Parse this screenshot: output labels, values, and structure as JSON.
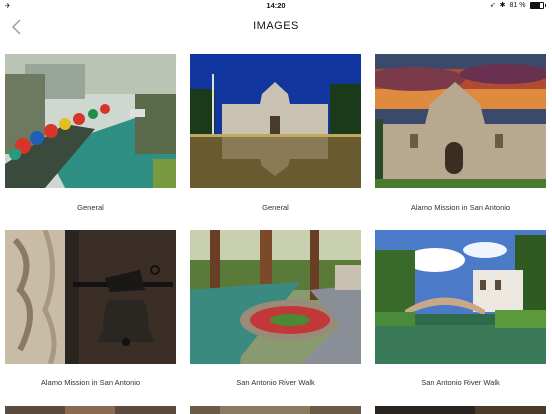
{
  "status": {
    "time": "14:20",
    "battery": "81 %",
    "battery_level": 0.81
  },
  "header": {
    "title": "IMAGES",
    "back_icon": "chevron-left-icon"
  },
  "images": [
    {
      "caption": "General"
    },
    {
      "caption": "General"
    },
    {
      "caption": "Alamo Mission in San Antonio"
    },
    {
      "caption": "Alamo Mission in San Antonio"
    },
    {
      "caption": "San Antonio River Walk"
    },
    {
      "caption": "San Antonio River Walk"
    }
  ]
}
